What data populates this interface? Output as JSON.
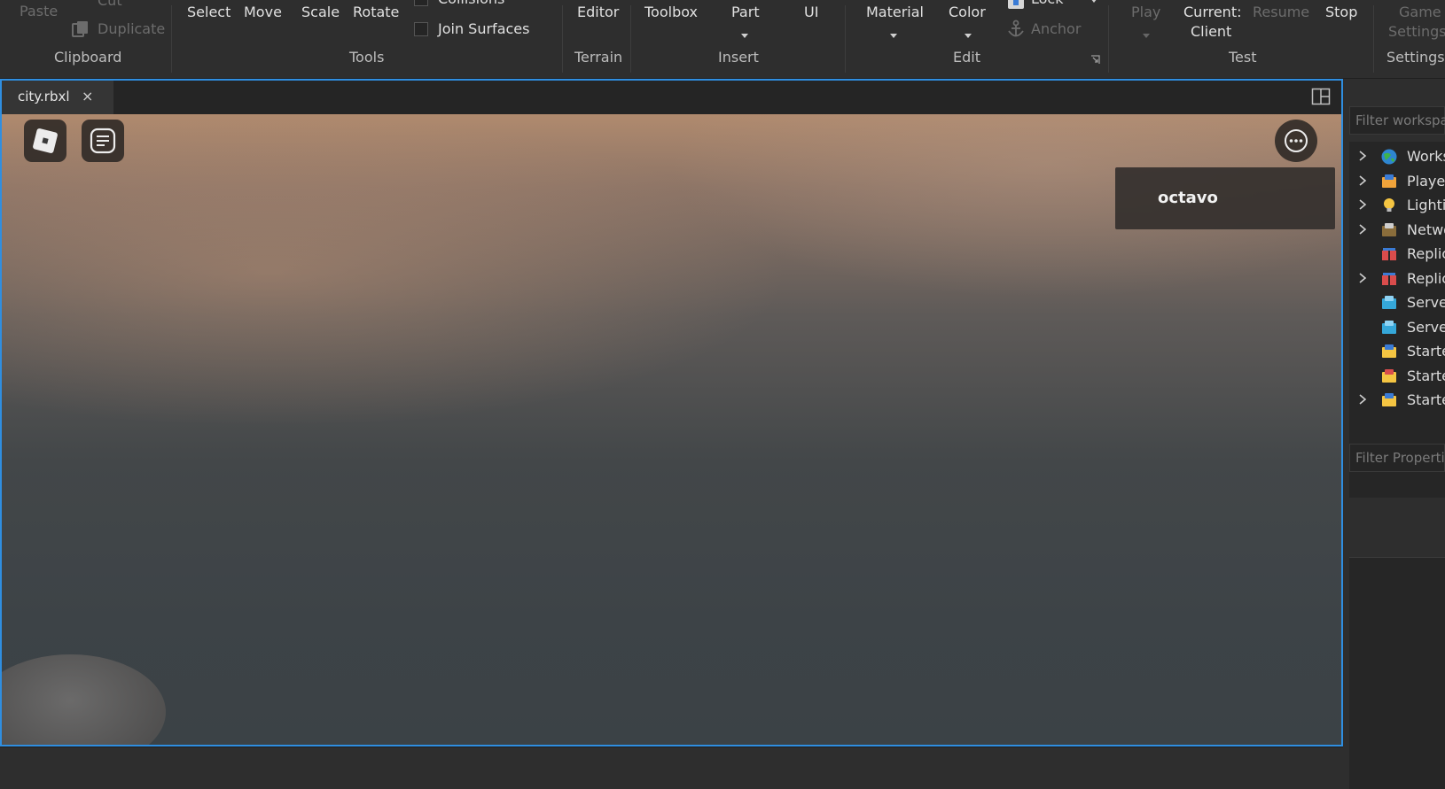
{
  "ribbon": {
    "clipboard": {
      "paste": "Paste",
      "cut": "Cut",
      "duplicate": "Duplicate",
      "group": "Clipboard"
    },
    "tools": {
      "select": "Select",
      "move": "Move",
      "scale": "Scale",
      "rotate": "Rotate",
      "collisions": "Collisions",
      "join_surfaces": "Join Surfaces",
      "group": "Tools"
    },
    "terrain": {
      "editor": "Editor",
      "group": "Terrain"
    },
    "insert": {
      "toolbox": "Toolbox",
      "part": "Part",
      "ui": "UI",
      "group": "Insert"
    },
    "edit": {
      "material": "Material",
      "color": "Color",
      "lock": "Lock",
      "anchor": "Anchor",
      "group": "Edit"
    },
    "test": {
      "play": "Play",
      "current_line1": "Current:",
      "current_line2": "Client",
      "resume": "Resume",
      "stop": "Stop",
      "group": "Test"
    },
    "settings": {
      "game_line1": "Game",
      "game_line2": "Settings",
      "group": "Settings"
    }
  },
  "document": {
    "tab_label": "city.rbxl",
    "close_symbol": "×"
  },
  "viewport": {
    "player_name": "octavo"
  },
  "explorer": {
    "filter_placeholder": "Filter workspace",
    "items": [
      {
        "label": "Workspace",
        "icon": "globe-icon",
        "expandable": true
      },
      {
        "label": "Players",
        "icon": "players-icon",
        "expandable": true
      },
      {
        "label": "Lighting",
        "icon": "lightbulb-icon",
        "expandable": true
      },
      {
        "label": "NetworkClient",
        "icon": "network-icon",
        "expandable": true
      },
      {
        "label": "ReplicatedFirst",
        "icon": "replicated-icon",
        "expandable": false
      },
      {
        "label": "ReplicatedStorage",
        "icon": "replicated-icon",
        "expandable": true
      },
      {
        "label": "ServerScriptService",
        "icon": "server-script-icon",
        "expandable": false
      },
      {
        "label": "ServerStorage",
        "icon": "server-storage-icon",
        "expandable": false
      },
      {
        "label": "StarterGui",
        "icon": "starter-gui-icon",
        "expandable": false
      },
      {
        "label": "StarterPack",
        "icon": "starter-pack-icon",
        "expandable": false
      },
      {
        "label": "StarterPlayer",
        "icon": "starter-player-icon",
        "expandable": true
      }
    ]
  },
  "properties": {
    "filter_placeholder": "Filter Properties"
  },
  "colors": {
    "accent": "#2f8ee0",
    "background": "#2e2e2e"
  }
}
